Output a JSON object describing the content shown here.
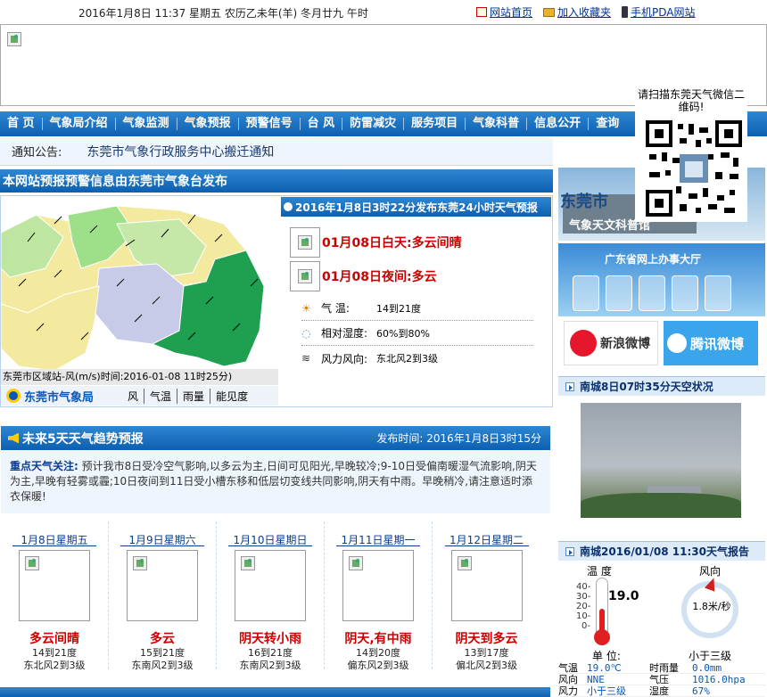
{
  "top": {
    "datetime": "2016年1月8日  11:37  星期五  农历乙未年(羊) 冬月廿九  午时",
    "links": [
      "网站首页",
      "加入收藏夹",
      "手机PDA网站"
    ]
  },
  "qr": {
    "text": "请扫描东莞天气微信二维码!"
  },
  "nav": [
    "首 页",
    "气象局介绍",
    "气象监测",
    "气象预报",
    "预警信号",
    "台 风",
    "防雷减灾",
    "服务项目",
    "气象科普",
    "信息公开",
    "查询"
  ],
  "notice": {
    "label": "通知公告:",
    "text": "东莞市气象行政服务中心搬迁通知"
  },
  "forecast_section": {
    "title": "本网站预报预警信息由东莞市气象台发布"
  },
  "map": {
    "caption": "东莞市区域站-风(m/s)时间:2016-01-08  11时25分)",
    "logo": "东莞市气象局",
    "tabs": [
      "风",
      "气温",
      "雨量",
      "能见度"
    ]
  },
  "forecast24": {
    "header": "2016年1月8日3时22分发布东莞24小时天气预报",
    "day": "01月08日白天:多云间晴",
    "night": "01月08日夜间:多云",
    "details": [
      {
        "label": "气    温:",
        "value": "14到21度"
      },
      {
        "label": "相对湿度:",
        "value": "60%到80%"
      },
      {
        "label": "风力风向:",
        "value": "东北风2到3级"
      }
    ]
  },
  "trend": {
    "title": "未来5天天气趋势预报",
    "publish": "发布时间: 2016年1月8日3时15分",
    "summary_label": "重点天气关注:",
    "summary": "预计我市8日受冷空气影响,以多云为主,日间可见阳光,早晚较冷;9-10日受偏南暖湿气流影响,阴天为主,早晚有轻雾或霾;10日夜间到11日受小槽东移和低层切变线共同影响,阴天有中雨。早晚稍冷,请注意适时添衣保暖!",
    "days": [
      {
        "date": "1月8日星期五",
        "cond": "多云间晴",
        "temp": "14到21度",
        "wind": "东北风2到3级"
      },
      {
        "date": "1月9日星期六",
        "cond": "多云",
        "temp": "15到21度",
        "wind": "东南风2到3级"
      },
      {
        "date": "1月10日星期日",
        "cond": "阴天转小雨",
        "temp": "16到21度",
        "wind": "东南风2到3级"
      },
      {
        "date": "1月11日星期一",
        "cond": "阴天,有中雨",
        "temp": "14到20度",
        "wind": "偏东风2到3级"
      },
      {
        "date": "1月12日星期二",
        "cond": "阴天到多云",
        "temp": "13到17度",
        "wind": "偏北风2到3级"
      }
    ]
  },
  "side": {
    "img1_text": "东莞市",
    "img1_sub": "气象天文科普馆",
    "img2_text": "广东省网上办事大厅",
    "weibo": "新浪微博",
    "tencent": "腾讯微博",
    "sky_title": "南城8日07时35分天空状况",
    "obs_title": "南城2016/01/08  11:30天气报告",
    "temp_label": "温  度",
    "temp_value": "19.0",
    "temp_ticks": [
      "40-",
      "30-",
      "20-",
      "10-",
      "0-"
    ],
    "unit_label": "单    位:",
    "wind_label": "风向",
    "wind_speed": "1.8米/秒",
    "wind_level": "小于三级",
    "table": [
      [
        "气温",
        "19.0℃",
        "时雨量",
        "0.0mm"
      ],
      [
        "风向",
        "NNE",
        "气压",
        "1016.0hpa"
      ],
      [
        "风力",
        "小于三级",
        "湿度",
        "67%"
      ]
    ]
  },
  "colors": {
    "nav_blue": "#0d5fb0",
    "alert_red": "#cc0000",
    "map_green": "#1fa050",
    "map_yellow": "#f3eaa0",
    "map_purple": "#c8cbe8"
  }
}
